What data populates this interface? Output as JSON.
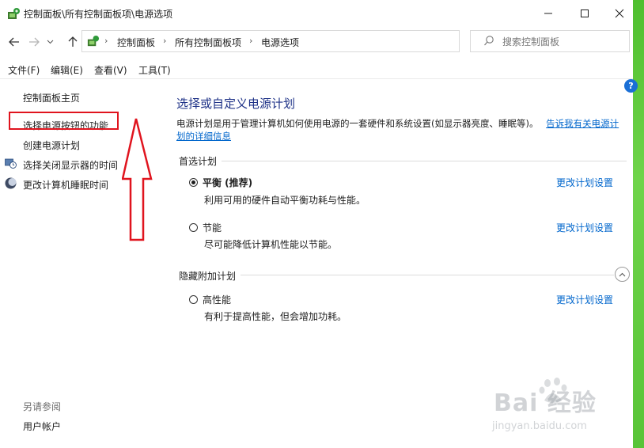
{
  "window": {
    "title": "控制面板\\所有控制面板项\\电源选项",
    "minimize_icon": "minimize-icon",
    "maximize_icon": "maximize-icon",
    "close_icon": "close-icon"
  },
  "nav": {
    "back_icon": "back-arrow-icon",
    "forward_icon": "forward-arrow-icon",
    "dropdown_icon": "chevron-down-icon",
    "up_icon": "up-arrow-icon",
    "breadcrumbs": [
      "控制面板",
      "所有控制面板项",
      "电源选项"
    ],
    "refresh_icon": "refresh-icon"
  },
  "search": {
    "placeholder": "搜索控制面板",
    "value": ""
  },
  "menu": {
    "items": [
      "文件(F)",
      "编辑(E)",
      "查看(V)",
      "工具(T)"
    ]
  },
  "left_pane": {
    "home": "控制面板主页",
    "links": [
      "选择电源按钮的功能",
      "创建电源计划",
      "选择关闭显示器的时间",
      "更改计算机睡眠时间"
    ],
    "see_also_title": "另请参阅",
    "see_also_links": [
      "用户帐户"
    ]
  },
  "main": {
    "title": "选择或自定义电源计划",
    "desc_line1": "电源计划是用于管理计算机如何使用电源的一套硬件和系统设置(如显示器亮度、睡眠等)。",
    "desc_link_part1": "告诉我有关电源计",
    "desc_link_part2": "划的详细信息",
    "preferred_label": "首选计划",
    "hidden_label": "隐藏附加计划",
    "plans": [
      {
        "name": "平衡 (推荐)",
        "desc": "利用可用的硬件自动平衡功耗与性能。",
        "link": "更改计划设置",
        "selected": true
      },
      {
        "name": "节能",
        "desc": "尽可能降低计算机性能以节能。",
        "link": "更改计划设置",
        "selected": false
      }
    ],
    "hidden_plans": [
      {
        "name": "高性能",
        "desc": "有利于提高性能，但会增加功耗。",
        "link": "更改计划设置",
        "selected": false
      }
    ]
  },
  "annotation": {
    "box_color": "#e0141e",
    "arrow_color": "#e0141e"
  },
  "watermark": {
    "line1": "Bai 经验",
    "line2": "jingyan.baidu.com"
  },
  "colors": {
    "title_blue": "#1e3287",
    "link_blue": "#0066cc",
    "help_blue": "#1a6fd6",
    "green_edge": "#58c437"
  }
}
